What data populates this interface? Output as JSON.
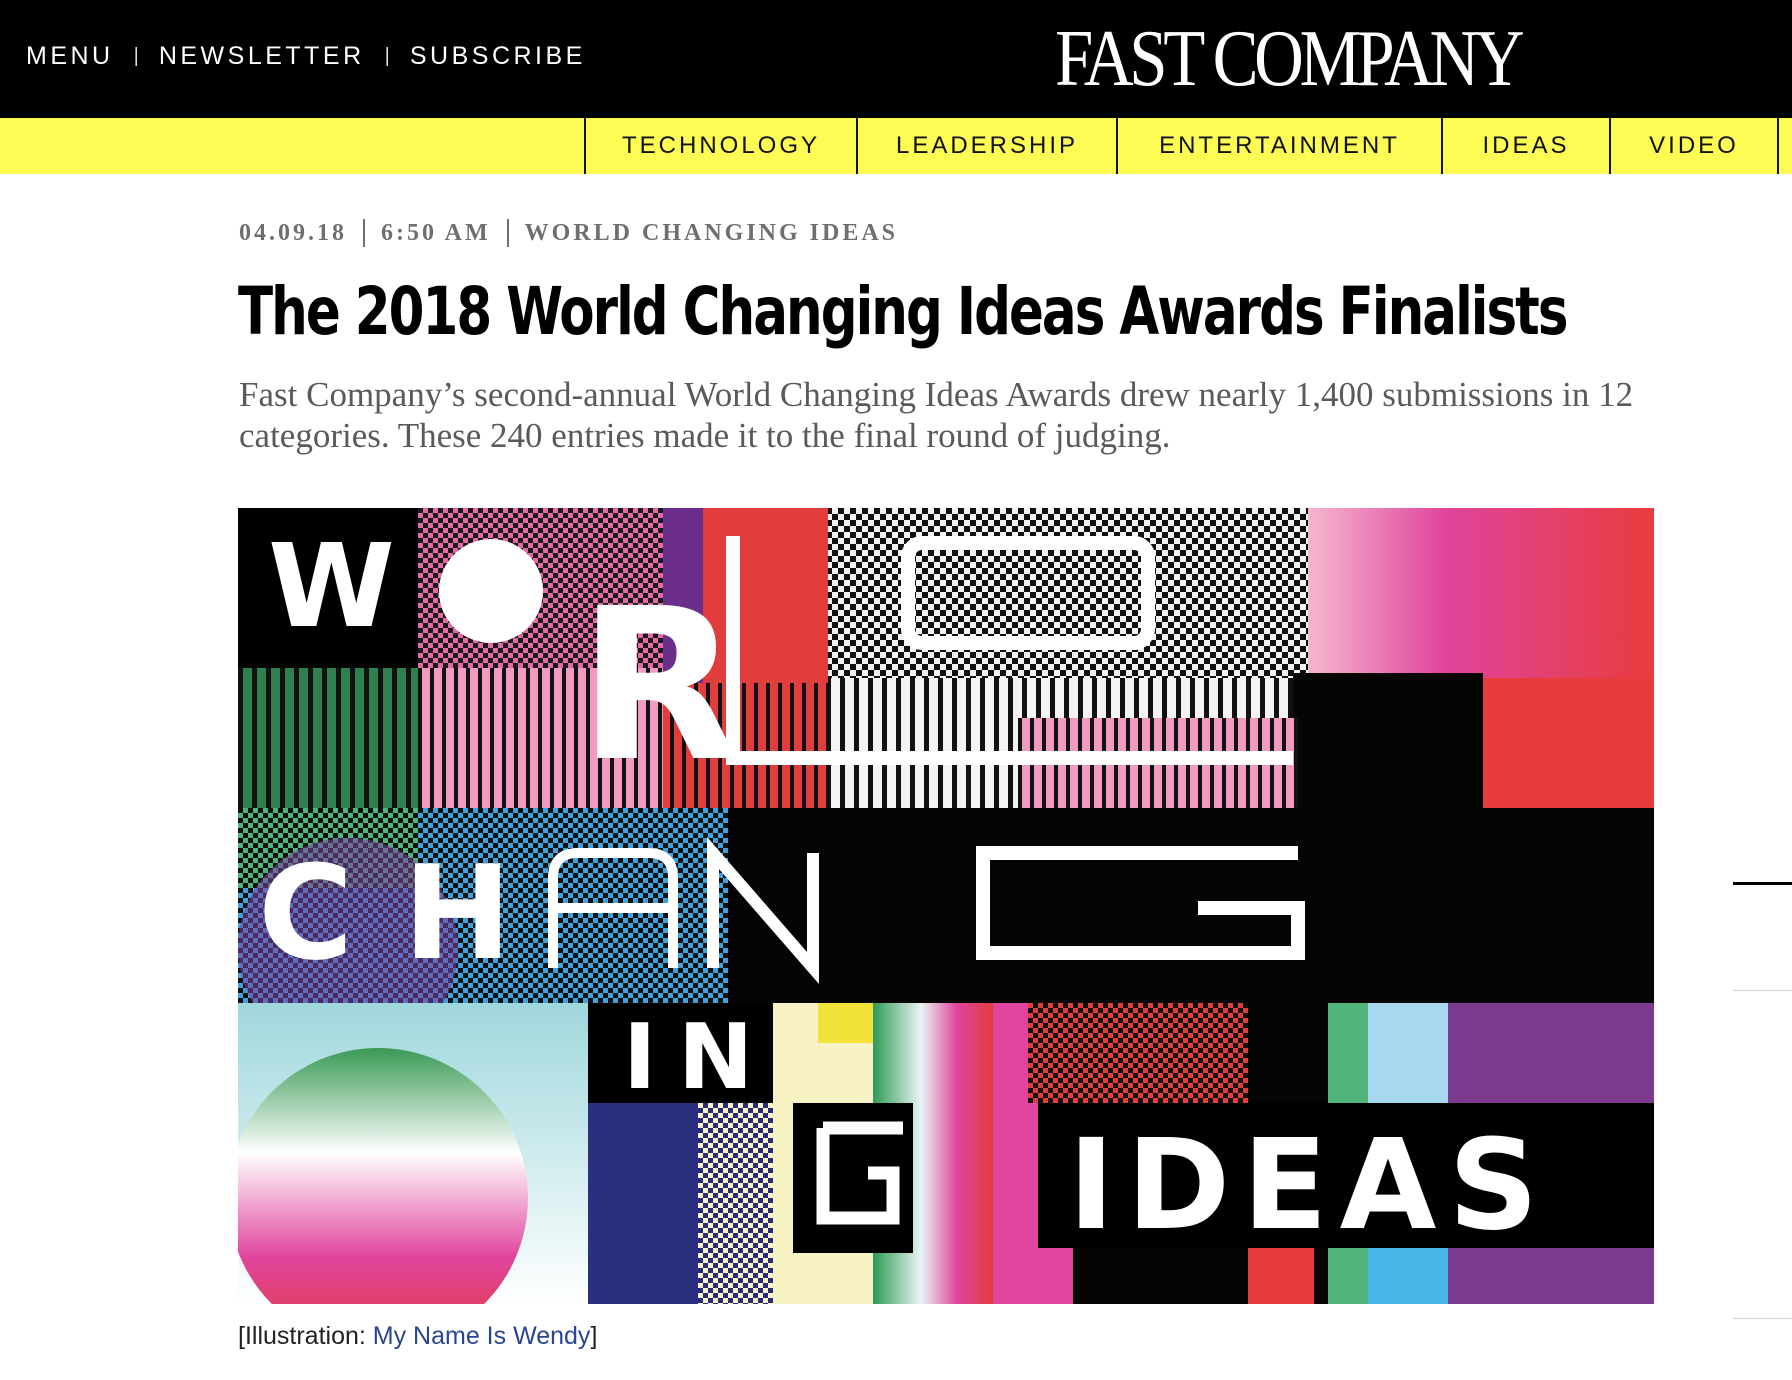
{
  "topnav": {
    "menu": "MENU",
    "newsletter": "NEWSLETTER",
    "subscribe": "SUBSCRIBE",
    "separator": "|"
  },
  "brand": {
    "name": "FAST COMPANY"
  },
  "sections": [
    "TECHNOLOGY",
    "LEADERSHIP",
    "ENTERTAINMENT",
    "IDEAS",
    "VIDEO"
  ],
  "article": {
    "date": "04.09.18",
    "time": "6:50 AM",
    "category": "WORLD CHANGING IDEAS",
    "title": "The 2018 World Changing Ideas Awards Finalists",
    "dek": "Fast Company’s second-annual World Changing Ideas Awards drew nearly 1,400 submissions in 12 categories. These 240 entries made it to the final round of judging."
  },
  "hero": {
    "letters": {
      "w": "W",
      "r": "R",
      "c": "C",
      "h": "H",
      "i": "I",
      "n": "N",
      "ideas": "IDEAS"
    }
  },
  "caption": {
    "open": "[Illustration: ",
    "credit": "My Name Is Wendy",
    "close": "]"
  },
  "colors": {
    "topbar": "#000000",
    "section_bar": "#fcfc54",
    "meta_grey": "#6f6f6f",
    "caption_link": "#28458f"
  },
  "icons": [
    "fast-company-logo"
  ]
}
